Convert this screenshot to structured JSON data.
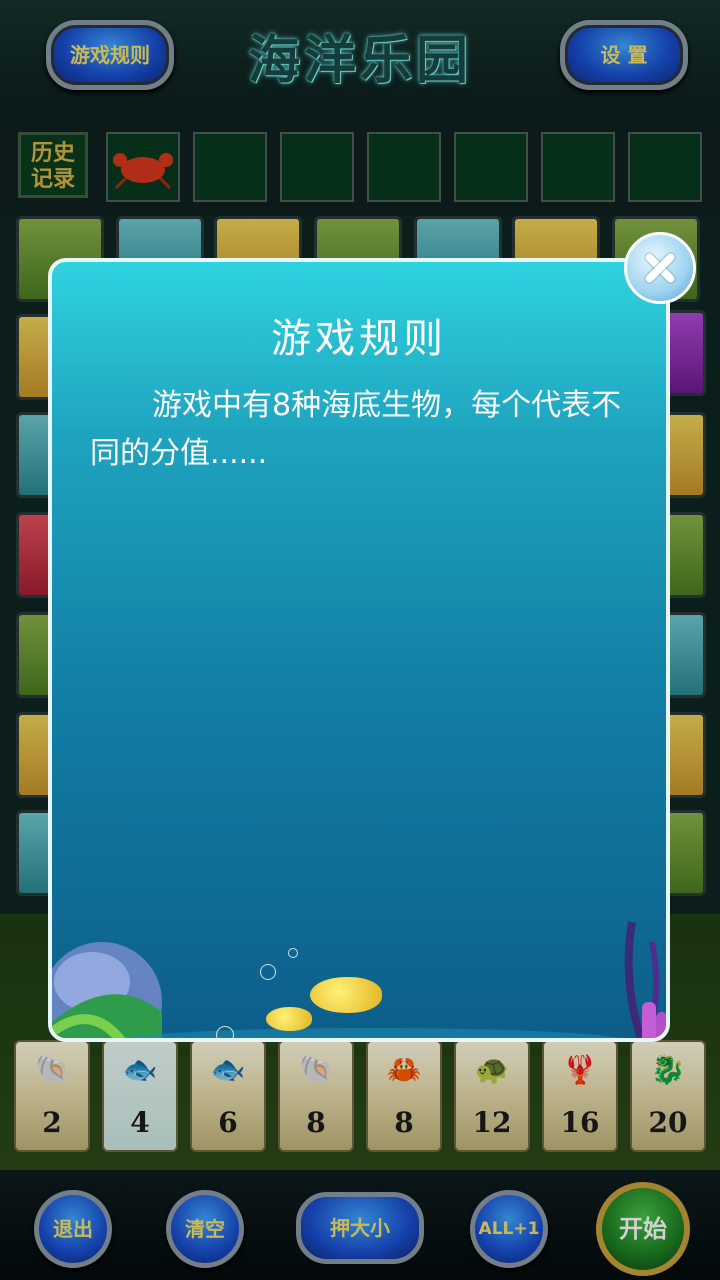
{
  "header": {
    "rules_label": "游戏规则",
    "title": "海洋乐园",
    "settings_label": "设  置"
  },
  "history": {
    "label_line1": "历史",
    "label_line2": "记录",
    "first_item_icon": "crab-icon"
  },
  "bets": [
    {
      "icon": "shell-icon",
      "glyph": "🐚",
      "value": "2"
    },
    {
      "icon": "pompano-icon",
      "glyph": "🐟",
      "value": "4"
    },
    {
      "icon": "sardine-icon",
      "glyph": "🐟",
      "value": "6"
    },
    {
      "icon": "nautilus-icon",
      "glyph": "🐚",
      "value": "8"
    },
    {
      "icon": "crab-icon",
      "glyph": "🦀",
      "value": "8"
    },
    {
      "icon": "turtle-icon",
      "glyph": "🐢",
      "value": "12"
    },
    {
      "icon": "lobster-icon",
      "glyph": "🦞",
      "value": "16"
    },
    {
      "icon": "seahorse-icon",
      "glyph": "🐉",
      "value": "20"
    }
  ],
  "footer": {
    "exit_label": "退出",
    "clear_label": "清空",
    "bet_size_label": "押大小",
    "all_plus_label": "ALL+1",
    "start_label": "开始"
  },
  "dialog": {
    "title": "游戏规则",
    "body": "游戏中有8种海底生物，每个代表不同的分值......"
  },
  "colors": {
    "button_text": "#f6e26a",
    "dialog_top": "#2fd3e0",
    "dialog_bottom": "#0d5e8a"
  }
}
